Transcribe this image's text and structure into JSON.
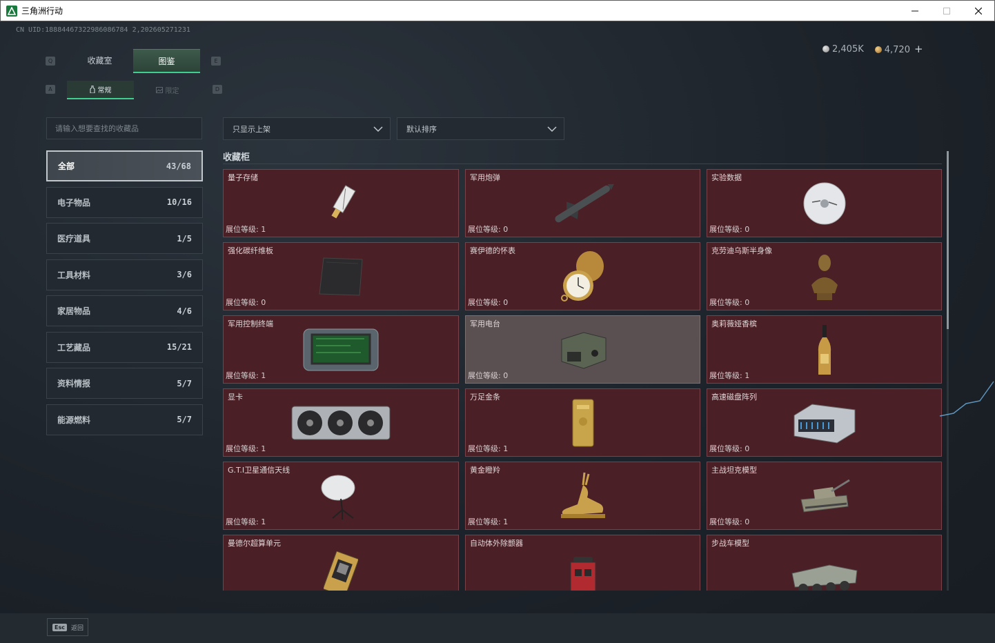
{
  "window": {
    "title": "三角洲行动"
  },
  "uid": "CN UID:18884467322986086784 2,202605271231",
  "currency": {
    "silver": "2,405K",
    "gold": "4,720",
    "add_label": "+"
  },
  "hints": {
    "q": "Q",
    "e": "E",
    "a": "A",
    "d": "D"
  },
  "main_tabs": [
    "收藏室",
    "图鉴"
  ],
  "sub_tabs": [
    "常规",
    "限定"
  ],
  "search": {
    "placeholder": "请输入想要查找的收藏品"
  },
  "categories": [
    {
      "label": "全部",
      "count": "43/68"
    },
    {
      "label": "电子物品",
      "count": "10/16"
    },
    {
      "label": "医疗道具",
      "count": "1/5"
    },
    {
      "label": "工具材料",
      "count": "3/6"
    },
    {
      "label": "家居物品",
      "count": "4/6"
    },
    {
      "label": "工艺藏品",
      "count": "15/21"
    },
    {
      "label": "资料情报",
      "count": "5/7"
    },
    {
      "label": "能源燃料",
      "count": "5/7"
    }
  ],
  "filters": {
    "shelf": "只显示上架",
    "sort": "默认排序"
  },
  "cabinet": {
    "title": "收藏柜",
    "items": [
      {
        "name": "量子存储",
        "level": "展位等级: 1"
      },
      {
        "name": "军用炮弹",
        "level": "展位等级: 0"
      },
      {
        "name": "实验数据",
        "level": "展位等级: 0"
      },
      {
        "name": "强化碳纤维板",
        "level": "展位等级: 0"
      },
      {
        "name": "赛伊德的怀表",
        "level": "展位等级: 0"
      },
      {
        "name": "克劳迪乌斯半身像",
        "level": "展位等级: 0"
      },
      {
        "name": "军用控制终端",
        "level": "展位等级: 1"
      },
      {
        "name": "军用电台",
        "level": "展位等级: 0"
      },
      {
        "name": "奥莉薇娅香槟",
        "level": "展位等级: 1"
      },
      {
        "name": "显卡",
        "level": "展位等级: 1"
      },
      {
        "name": "万足金条",
        "level": "展位等级: 1"
      },
      {
        "name": "高速磁盘阵列",
        "level": "展位等级: 0"
      },
      {
        "name": "G.T.I卫星通信天线",
        "level": "展位等级: 1"
      },
      {
        "name": "黄金瞪羚",
        "level": "展位等级: 1"
      },
      {
        "name": "主战坦克模型",
        "level": "展位等级: 0"
      },
      {
        "name": "曼德尔超算单元",
        "level": ""
      },
      {
        "name": "自动体外除颤器",
        "level": ""
      },
      {
        "name": "步战车模型",
        "level": ""
      }
    ]
  },
  "footer": {
    "esc_key": "Esc",
    "back_label": "返回"
  }
}
